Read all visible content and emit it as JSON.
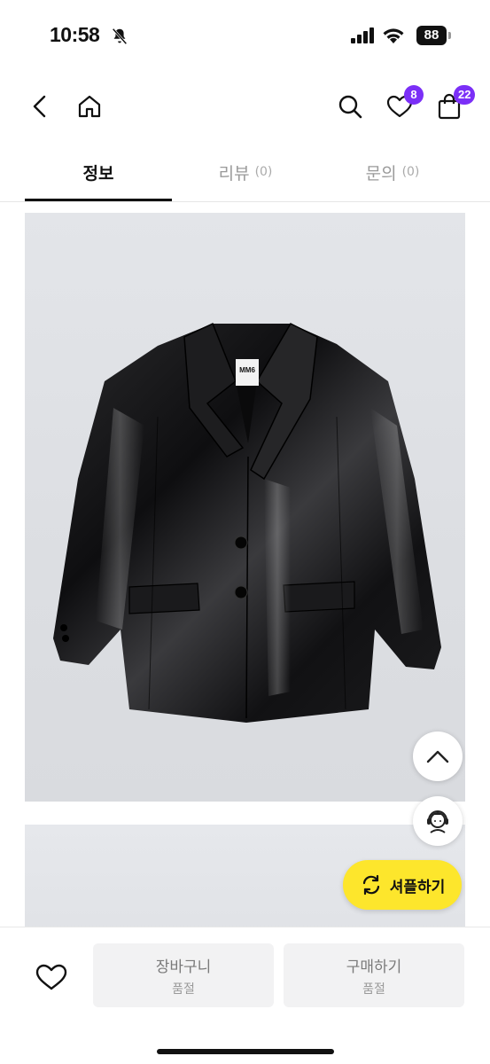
{
  "status_bar": {
    "time": "10:58",
    "battery": "88"
  },
  "header": {
    "wishlist_count": "8",
    "cart_count": "22",
    "icons": [
      "back-icon",
      "home-icon",
      "search-icon",
      "heart-icon",
      "shopping-bag-icon"
    ]
  },
  "tabs": [
    {
      "label": "정보",
      "count": ""
    },
    {
      "label": "리뷰",
      "count": "(0)"
    },
    {
      "label": "문의",
      "count": "(0)"
    }
  ],
  "product": {
    "garment_label": "MM6"
  },
  "floating": {
    "shuffle_label": "셔플하기"
  },
  "bottom_bar": {
    "cart_label": "장바구니",
    "cart_status": "품절",
    "buy_label": "구매하기",
    "buy_status": "품절"
  },
  "colors": {
    "accent_badge": "#7b2ff7",
    "shuffle_button": "#fde62c",
    "active_tab": "#111111"
  }
}
